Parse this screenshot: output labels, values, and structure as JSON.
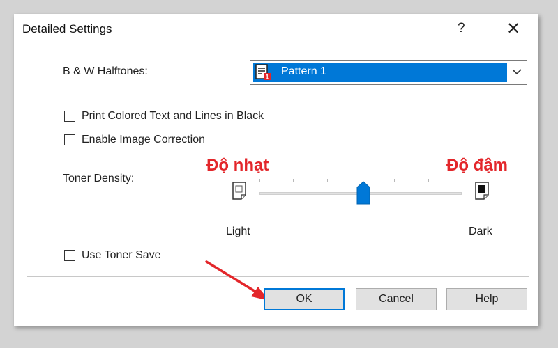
{
  "dialog": {
    "title": "Detailed Settings",
    "help_glyph": "?",
    "close_glyph": "✕"
  },
  "halftone": {
    "label": "B & W Halftones:",
    "selected": "Pattern 1",
    "icon": "pattern-icon"
  },
  "options": {
    "print_colored_black": {
      "label": "Print Colored Text and Lines in Black",
      "checked": false
    },
    "enable_image_correction": {
      "label": "Enable Image Correction",
      "checked": false
    },
    "use_toner_save": {
      "label": "Use Toner Save",
      "checked": false
    }
  },
  "toner": {
    "label": "Toner Density:",
    "light_label": "Light",
    "dark_label": "Dark",
    "level_fraction": 0.5,
    "tick_count": 7
  },
  "annotations": {
    "light_overlay": "Độ nhạt",
    "dark_overlay": "Độ đậm",
    "overlay_color": "#e3262a"
  },
  "buttons": {
    "ok": "OK",
    "cancel": "Cancel",
    "help": "Help"
  },
  "colors": {
    "accent": "#0078d7",
    "background": "#d3d3d3"
  }
}
